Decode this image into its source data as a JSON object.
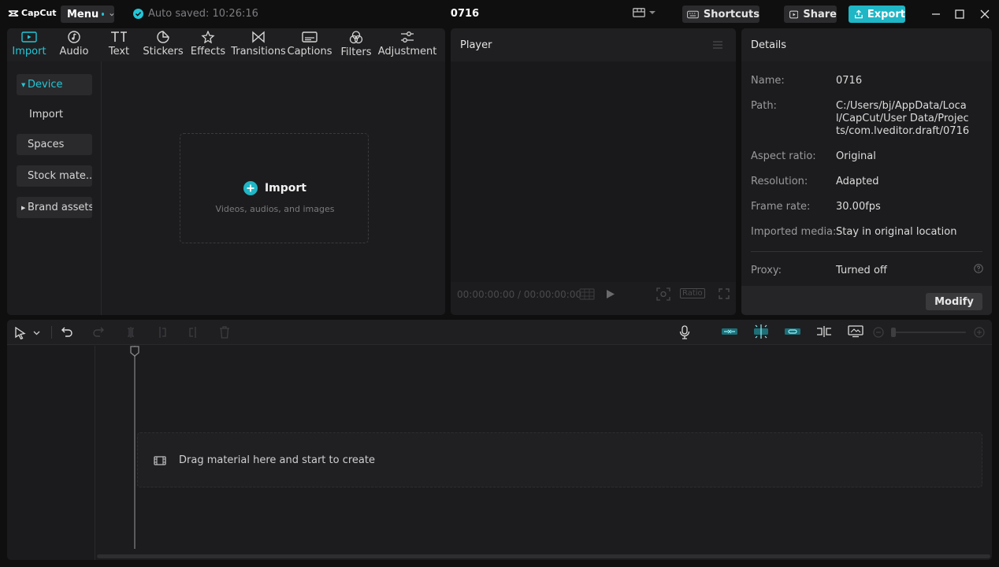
{
  "app": {
    "logo_text": "CapCut",
    "project_title": "0716",
    "accent_color": "#1fb6c6"
  },
  "titlebar": {
    "menu_label": "Menu",
    "autosave_text": "Auto saved: 10:26:16",
    "shortcuts_label": "Shortcuts",
    "share_label": "Share",
    "export_label": "Export",
    "icons": [
      "layout-icon",
      "keyboard-icon",
      "share-icon",
      "export-icon",
      "minimize-icon",
      "maximize-icon",
      "close-icon"
    ]
  },
  "media": {
    "tabs": [
      {
        "label": "Import",
        "icon": "import-icon",
        "active": true
      },
      {
        "label": "Audio",
        "icon": "audio-icon"
      },
      {
        "label": "Text",
        "icon": "text-icon"
      },
      {
        "label": "Stickers",
        "icon": "sticker-icon"
      },
      {
        "label": "Effects",
        "icon": "effects-icon"
      },
      {
        "label": "Transitions",
        "icon": "transitions-icon"
      },
      {
        "label": "Captions",
        "icon": "captions-icon"
      },
      {
        "label": "Filters",
        "icon": "filters-icon"
      },
      {
        "label": "Adjustment",
        "icon": "adjustment-icon"
      }
    ],
    "sidebar": [
      {
        "label": "Device",
        "active": true
      },
      {
        "label": "Import"
      },
      {
        "label": "Spaces"
      },
      {
        "label": "Stock mate..."
      },
      {
        "label": "Brand assets"
      }
    ],
    "dropzone": {
      "title": "Import",
      "subtitle": "Videos, audios, and images"
    }
  },
  "player": {
    "title": "Player",
    "timecode": "00:00:00:00 / 00:00:00:00",
    "ratio_label": "Ratio"
  },
  "details": {
    "title": "Details",
    "rows": [
      {
        "label": "Name:",
        "value": "0716"
      },
      {
        "label": "Path:",
        "value": "C:/Users/bj/AppData/Local/CapCut/User Data/Projects/com.lveditor.draft/0716"
      },
      {
        "label": "Aspect ratio:",
        "value": "Original"
      },
      {
        "label": "Resolution:",
        "value": "Adapted"
      },
      {
        "label": "Frame rate:",
        "value": "30.00fps"
      },
      {
        "label": "Imported media:",
        "value": "Stay in original location"
      },
      {
        "label": "Proxy:",
        "value": "Turned off"
      }
    ],
    "modify_label": "Modify"
  },
  "timeline": {
    "drop_text": "Drag material here and start to create"
  }
}
